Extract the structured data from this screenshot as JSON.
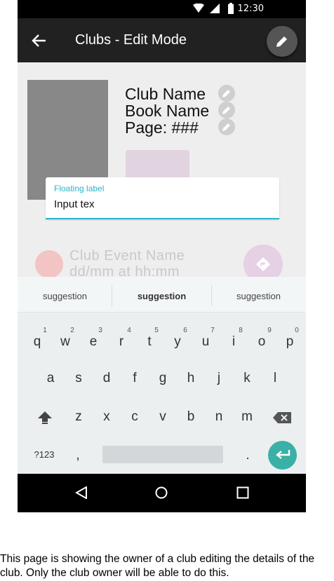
{
  "status_bar": {
    "time": "12:30",
    "icons": [
      "wifi-icon",
      "signal-icon",
      "battery-icon"
    ]
  },
  "app_bar": {
    "title": "Clubs - Edit Mode",
    "back_icon": "arrow-back-icon",
    "edit_icon": "pencil-icon"
  },
  "club": {
    "club_name": "Club Name",
    "book_name": "Book Name",
    "page": "Page: ###"
  },
  "text_field": {
    "label": "Floating label",
    "value": "Input tex"
  },
  "event": {
    "name": "Club Event Name",
    "datetime": "dd/mm at hh:mm",
    "action_icon": "directions-icon"
  },
  "keyboard": {
    "suggestions": [
      "suggestion",
      "suggestion",
      "suggestion"
    ],
    "row1": [
      "q",
      "w",
      "e",
      "r",
      "t",
      "y",
      "u",
      "i",
      "o",
      "p"
    ],
    "row1_hints": [
      "1",
      "2",
      "3",
      "4",
      "5",
      "6",
      "7",
      "8",
      "9",
      "0"
    ],
    "row2": [
      "a",
      "s",
      "d",
      "f",
      "g",
      "h",
      "j",
      "k",
      "l"
    ],
    "row3": [
      "z",
      "x",
      "c",
      "v",
      "b",
      "n",
      "m"
    ],
    "symbols_key": "?123",
    "comma_key": ",",
    "period_key": ".",
    "enter_color": "#3ab0a6"
  },
  "nav_bar": {
    "icons": [
      "back-triangle-icon",
      "home-circle-icon",
      "recents-square-icon"
    ]
  },
  "caption": "This page is showing the owner of a club editing the details of the club. Only the club owner will be able to do this."
}
